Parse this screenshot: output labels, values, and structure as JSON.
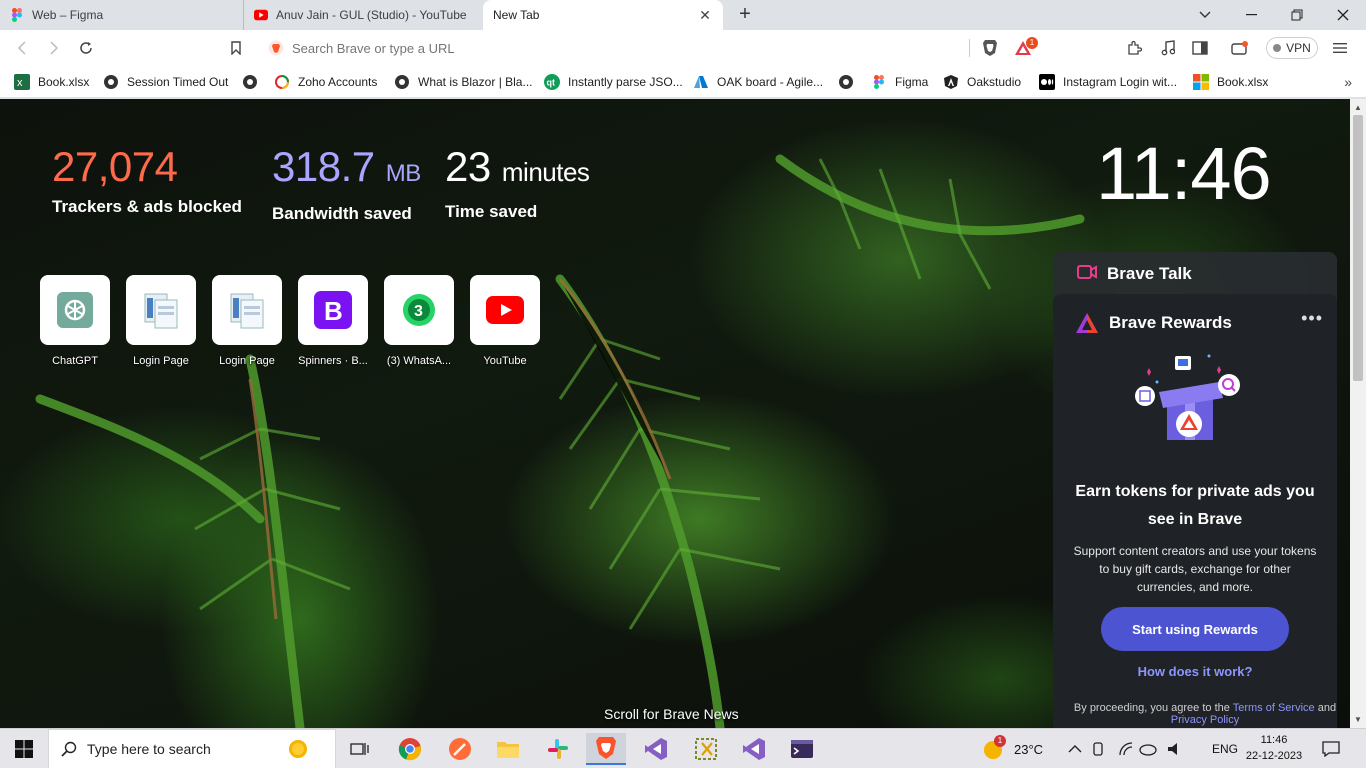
{
  "tabs": [
    {
      "title": "Web – Figma",
      "favicon": "figma-icon",
      "active": false
    },
    {
      "title": "Anuv Jain - GUL (Studio) - YouTube",
      "favicon": "youtube-icon",
      "active": false
    },
    {
      "title": "New Tab",
      "favicon": "",
      "active": true
    }
  ],
  "toolbar": {
    "search_placeholder": "Search Brave or type a URL",
    "rewards_badge": "1",
    "vpn_label": "VPN"
  },
  "bookmarks": [
    {
      "label": "Book.xlsx",
      "icon": "excel-icon"
    },
    {
      "label": "Session Timed Out",
      "icon": "globe-icon"
    },
    {
      "label": "",
      "icon": "globe-icon"
    },
    {
      "label": "Zoho Accounts",
      "icon": "zoho-icon"
    },
    {
      "label": "What is Blazor | Bla...",
      "icon": "globe-icon"
    },
    {
      "label": "Instantly parse JSO...",
      "icon": "quicktype-icon"
    },
    {
      "label": "OAK board - Agile...",
      "icon": "azure-icon"
    },
    {
      "label": "",
      "icon": "globe-icon"
    },
    {
      "label": "Figma",
      "icon": "figma-icon"
    },
    {
      "label": "Oakstudio",
      "icon": "angular-icon"
    },
    {
      "label": "Instagram Login wit...",
      "icon": "medium-icon"
    },
    {
      "label": "Book.xlsx",
      "icon": "office-icon"
    }
  ],
  "stats": {
    "trackers": {
      "value": "27,074",
      "label": "Trackers & ads blocked"
    },
    "bandwidth": {
      "value": "318.7",
      "unit": "MB",
      "label": "Bandwidth saved"
    },
    "time": {
      "value": "23",
      "unit": "minutes",
      "label": "Time saved"
    }
  },
  "clock": "11:46",
  "top_sites": [
    {
      "name": "ChatGPT",
      "icon": "chatgpt-icon"
    },
    {
      "name": "Login Page",
      "icon": "page-icon"
    },
    {
      "name": "Login Page",
      "icon": "page-icon"
    },
    {
      "name": "Spinners · B...",
      "icon": "bootstrap-icon"
    },
    {
      "name": "(3) WhatsA...",
      "icon": "whatsapp-icon"
    },
    {
      "name": "YouTube",
      "icon": "youtube-icon"
    }
  ],
  "scroll_news": "Scroll for Brave News",
  "widgets": {
    "talk_title": "Brave Talk",
    "rewards_title": "Brave Rewards",
    "rewards_heading": "Earn tokens for private ads you see in Brave",
    "rewards_desc": "Support content creators and use your tokens to buy gift cards, exchange for other currencies, and more.",
    "rewards_cta": "Start using Rewards",
    "rewards_how": "How does it work?",
    "legal_prefix": "By proceeding, you agree to the",
    "legal_tos": "Terms of Service",
    "legal_and": "and",
    "legal_privacy": "Privacy Policy"
  },
  "taskbar": {
    "search_placeholder": "Type here to search",
    "weather_temp": "23°C",
    "weather_badge": "1",
    "language": "ENG",
    "time": "11:46",
    "date": "22-12-2023"
  },
  "colors": {
    "trackers": "#ff6a4c",
    "bandwidth": "#aaa6ff",
    "cta": "#4c54d2",
    "link": "#8c96ff"
  }
}
